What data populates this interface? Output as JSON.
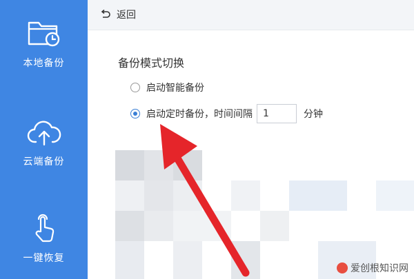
{
  "sidebar": {
    "items": [
      {
        "label": "本地备份",
        "icon": "folder-clock-icon"
      },
      {
        "label": "云端备份",
        "icon": "cloud-upload-icon"
      },
      {
        "label": "一键恢复",
        "icon": "tap-hand-icon"
      }
    ],
    "bg_color": "#3f86e3"
  },
  "topbar": {
    "back_label": "返回"
  },
  "settings": {
    "title": "备份模式切换",
    "option_smart": "启动智能备份",
    "option_timed": "启动定时备份，时间间隔",
    "interval_value": "1",
    "interval_unit": "分钟",
    "selected": "timed"
  },
  "annotation": {
    "arrow_color": "#e5252a"
  },
  "watermark": {
    "text": "爱创根知识网"
  }
}
